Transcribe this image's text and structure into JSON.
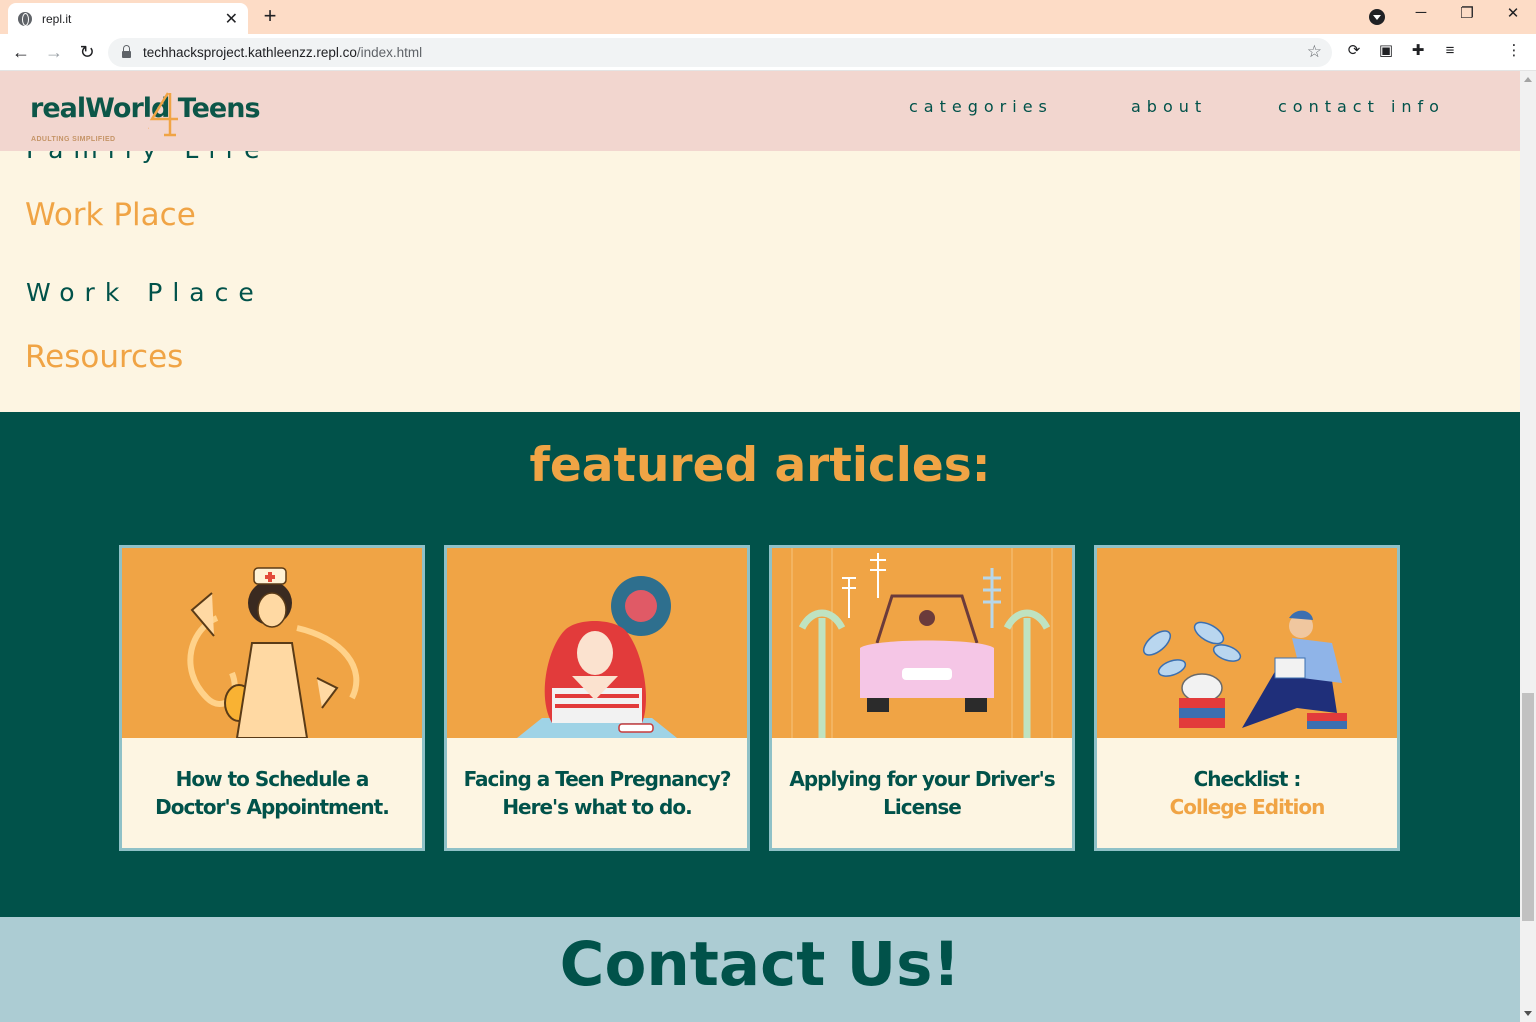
{
  "browser": {
    "tab_title": "repl.it",
    "url_domain": "techhacksproject.kathleenzz.repl.co",
    "url_path": "/index.html"
  },
  "header": {
    "logo_text": "realWorld Teens",
    "logo_numeral": "4",
    "tagline": "ADULTING SIMPLIFIED",
    "nav": [
      "categories",
      "about",
      "contact info"
    ]
  },
  "categories": {
    "partial_sub": "Family Life",
    "workplace_heading": "Work Place",
    "workplace_sub": "Work Place",
    "resources_heading": "Resources"
  },
  "featured": {
    "title": "featured articles:",
    "cards": [
      {
        "line1": "How to Schedule a",
        "line2": "Doctor's Appointment."
      },
      {
        "line1": "Facing a Teen Pregnancy?",
        "line2": "Here's what to do."
      },
      {
        "line1": "Applying for your Driver's",
        "line2": "License"
      },
      {
        "line1": "Checklist :",
        "line2": "College Edition"
      }
    ]
  },
  "contact": {
    "title": "Contact Us!"
  },
  "colors": {
    "brand_green": "#01524a",
    "accent_orange": "#f0a445",
    "cream": "#fdf5e2",
    "header_pink": "#f2d6cf",
    "contact_blue": "#acccd3"
  }
}
